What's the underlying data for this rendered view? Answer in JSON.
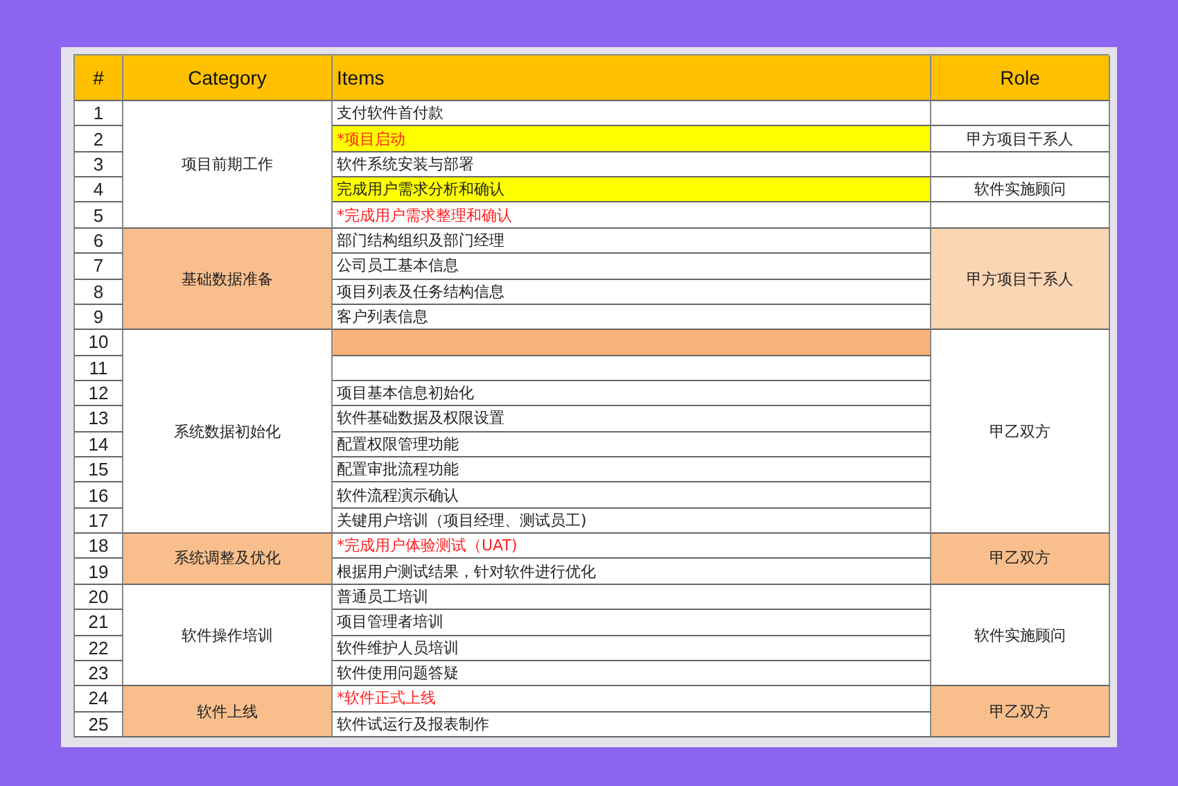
{
  "table": {
    "columns": [
      "#",
      "Category",
      "Items",
      "Role"
    ],
    "rows": [
      {
        "num": "1",
        "item": "支付软件首付款",
        "color": "#ffffff",
        "red": false,
        "category": {
          "label": "项目前期工作",
          "shaded": false
        },
        "role": {
          "shaded": false
        }
      },
      {
        "num": "2",
        "item": "*项目启动",
        "color": "#ffff00",
        "red": true,
        "role": {
          "label": "甲方项目干系人",
          "shaded": false
        }
      },
      {
        "num": "3",
        "item": "软件系统安装与部署",
        "color": "#ffffff",
        "red": false,
        "role": {
          "shaded": false
        }
      },
      {
        "num": "4",
        "item": "完成用户需求分析和确认",
        "color": "#ffff00",
        "red": false,
        "role": {
          "label": "软件实施顾问",
          "shaded": false
        }
      },
      {
        "num": "5",
        "item": "*完成用户需求整理和确认",
        "color": "#ffffff",
        "red": true,
        "role": {
          "shaded": false
        }
      },
      {
        "num": "6",
        "item": "部门结构组织及部门经理",
        "color": "#ffffff",
        "red": false,
        "category": {
          "label": "基础数据准备",
          "shaded": true
        },
        "role": {
          "label": "甲方项目干系人",
          "shaded": true
        }
      },
      {
        "num": "7",
        "item": "公司员工基本信息",
        "color": "#ffffff",
        "red": false
      },
      {
        "num": "8",
        "item": "项目列表及任务结构信息",
        "color": "#ffffff",
        "red": false
      },
      {
        "num": "9",
        "item": "客户列表信息",
        "color": "#ffffff",
        "red": false
      },
      {
        "num": "10",
        "color": "#f9b27a",
        "category": {
          "label": "系统数据初始化",
          "shaded": false
        },
        "role": {
          "label": "甲乙双方",
          "shaded": false
        }
      },
      {
        "num": "11",
        "color": "#ffffff"
      },
      {
        "num": "12",
        "item": "项目基本信息初始化",
        "color": "#ffffff",
        "red": false
      },
      {
        "num": "13",
        "item": "软件基础数据及权限设置",
        "color": "#ffffff",
        "red": false
      },
      {
        "num": "14",
        "item": "配置权限管理功能",
        "color": "#ffffff",
        "red": false
      },
      {
        "num": "15",
        "item": "配置审批流程功能",
        "color": "#ffffff",
        "red": false
      },
      {
        "num": "16",
        "item": "软件流程演示确认",
        "color": "#ffffff",
        "red": false
      },
      {
        "num": "17",
        "item": "关键用户培训（项目经理、测试员工)",
        "color": "#ffffff",
        "red": false
      },
      {
        "num": "18",
        "item": "*完成用户体验测试（UAT)",
        "color": "#ffffff",
        "red": true,
        "category": {
          "label": "系统调整及优化",
          "shaded": true
        },
        "role": {
          "label": "甲乙双方",
          "shaded": true
        }
      },
      {
        "num": "19",
        "item": "根据用户测试结果，针对软件进行优化",
        "color": "#ffffff",
        "red": false
      },
      {
        "num": "20",
        "item": "普通员工培训",
        "color": "#ffffff",
        "red": false,
        "category": {
          "label": "软件操作培训",
          "shaded": false
        },
        "role": {
          "label": "软件实施顾问",
          "shaded": false
        }
      },
      {
        "num": "21",
        "item": "项目管理者培训",
        "color": "#ffffff",
        "red": false
      },
      {
        "num": "22",
        "item": "软件维护人员培训",
        "color": "#ffffff",
        "red": false
      },
      {
        "num": "23",
        "item": "软件使用问题答疑",
        "color": "#ffffff",
        "red": false
      },
      {
        "num": "24",
        "item": "*软件正式上线",
        "color": "#ffffff",
        "red": true,
        "category": {
          "label": "软件上线",
          "shaded": true
        },
        "role": {
          "label": "甲乙双方",
          "shaded": true
        }
      },
      {
        "num": "25",
        "item": "软件试运行及报表制作",
        "color": "#ffffff",
        "red": false
      }
    ]
  }
}
